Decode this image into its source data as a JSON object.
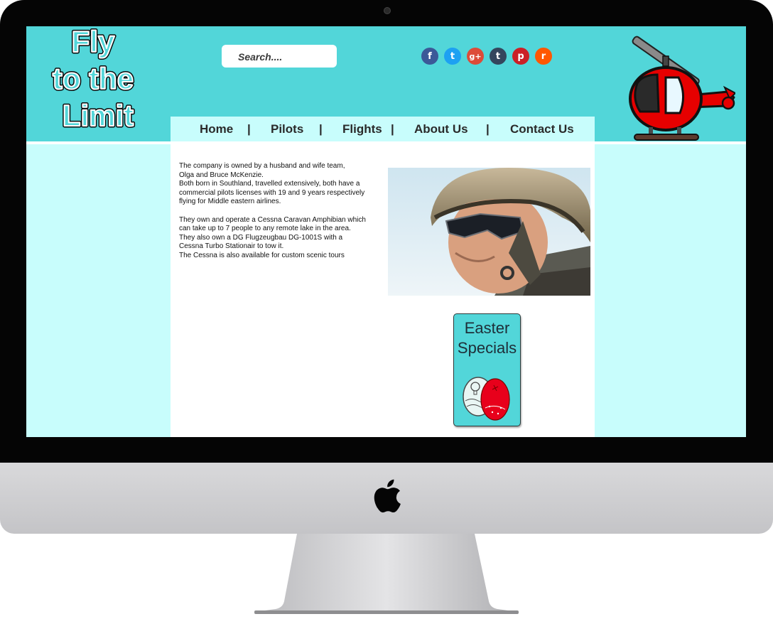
{
  "site": {
    "logo_text": "Fly to the Limit"
  },
  "search": {
    "placeholder": "Search...."
  },
  "social": [
    {
      "icon": "facebook-icon",
      "glyph": "f",
      "color": "#3b5998"
    },
    {
      "icon": "twitter-icon",
      "glyph": "t",
      "color": "#1da1f2"
    },
    {
      "icon": "google-plus-icon",
      "glyph": "g+",
      "color": "#dd4b39"
    },
    {
      "icon": "tumblr-icon",
      "glyph": "t",
      "color": "#34465d"
    },
    {
      "icon": "pinterest-icon",
      "glyph": "p",
      "color": "#cb2027"
    },
    {
      "icon": "reddit-icon",
      "glyph": "r",
      "color": "#ff5700"
    }
  ],
  "nav": {
    "items": [
      "Home",
      "Pilots",
      "Flights",
      "About Us",
      "Contact Us"
    ],
    "separator": "|"
  },
  "about": {
    "paragraph1": [
      "The company is owned by a husband and wife team,",
      "Olga and Bruce McKenzie.",
      "Both born in Southland, travelled extensively, both have a",
      "commercial pilots licenses with 19 and 9 years respectively",
      "flying for Middle eastern airlines."
    ],
    "paragraph2": [
      "They own and operate a Cessna Caravan Amphibian which",
      "can take up to 7 people to any remote lake in the area.",
      "They also own a DG Flugzeugbau DG-1001S with a",
      "Cessna Turbo Stationair to tow it.",
      "The Cessna is also available for custom scenic tours"
    ]
  },
  "promo": {
    "line1": "Easter",
    "line2": "Specials"
  },
  "colors": {
    "header": "#52d6d9",
    "background": "#c8fdfc",
    "content": "#ffffff",
    "bezel": "#050505"
  }
}
